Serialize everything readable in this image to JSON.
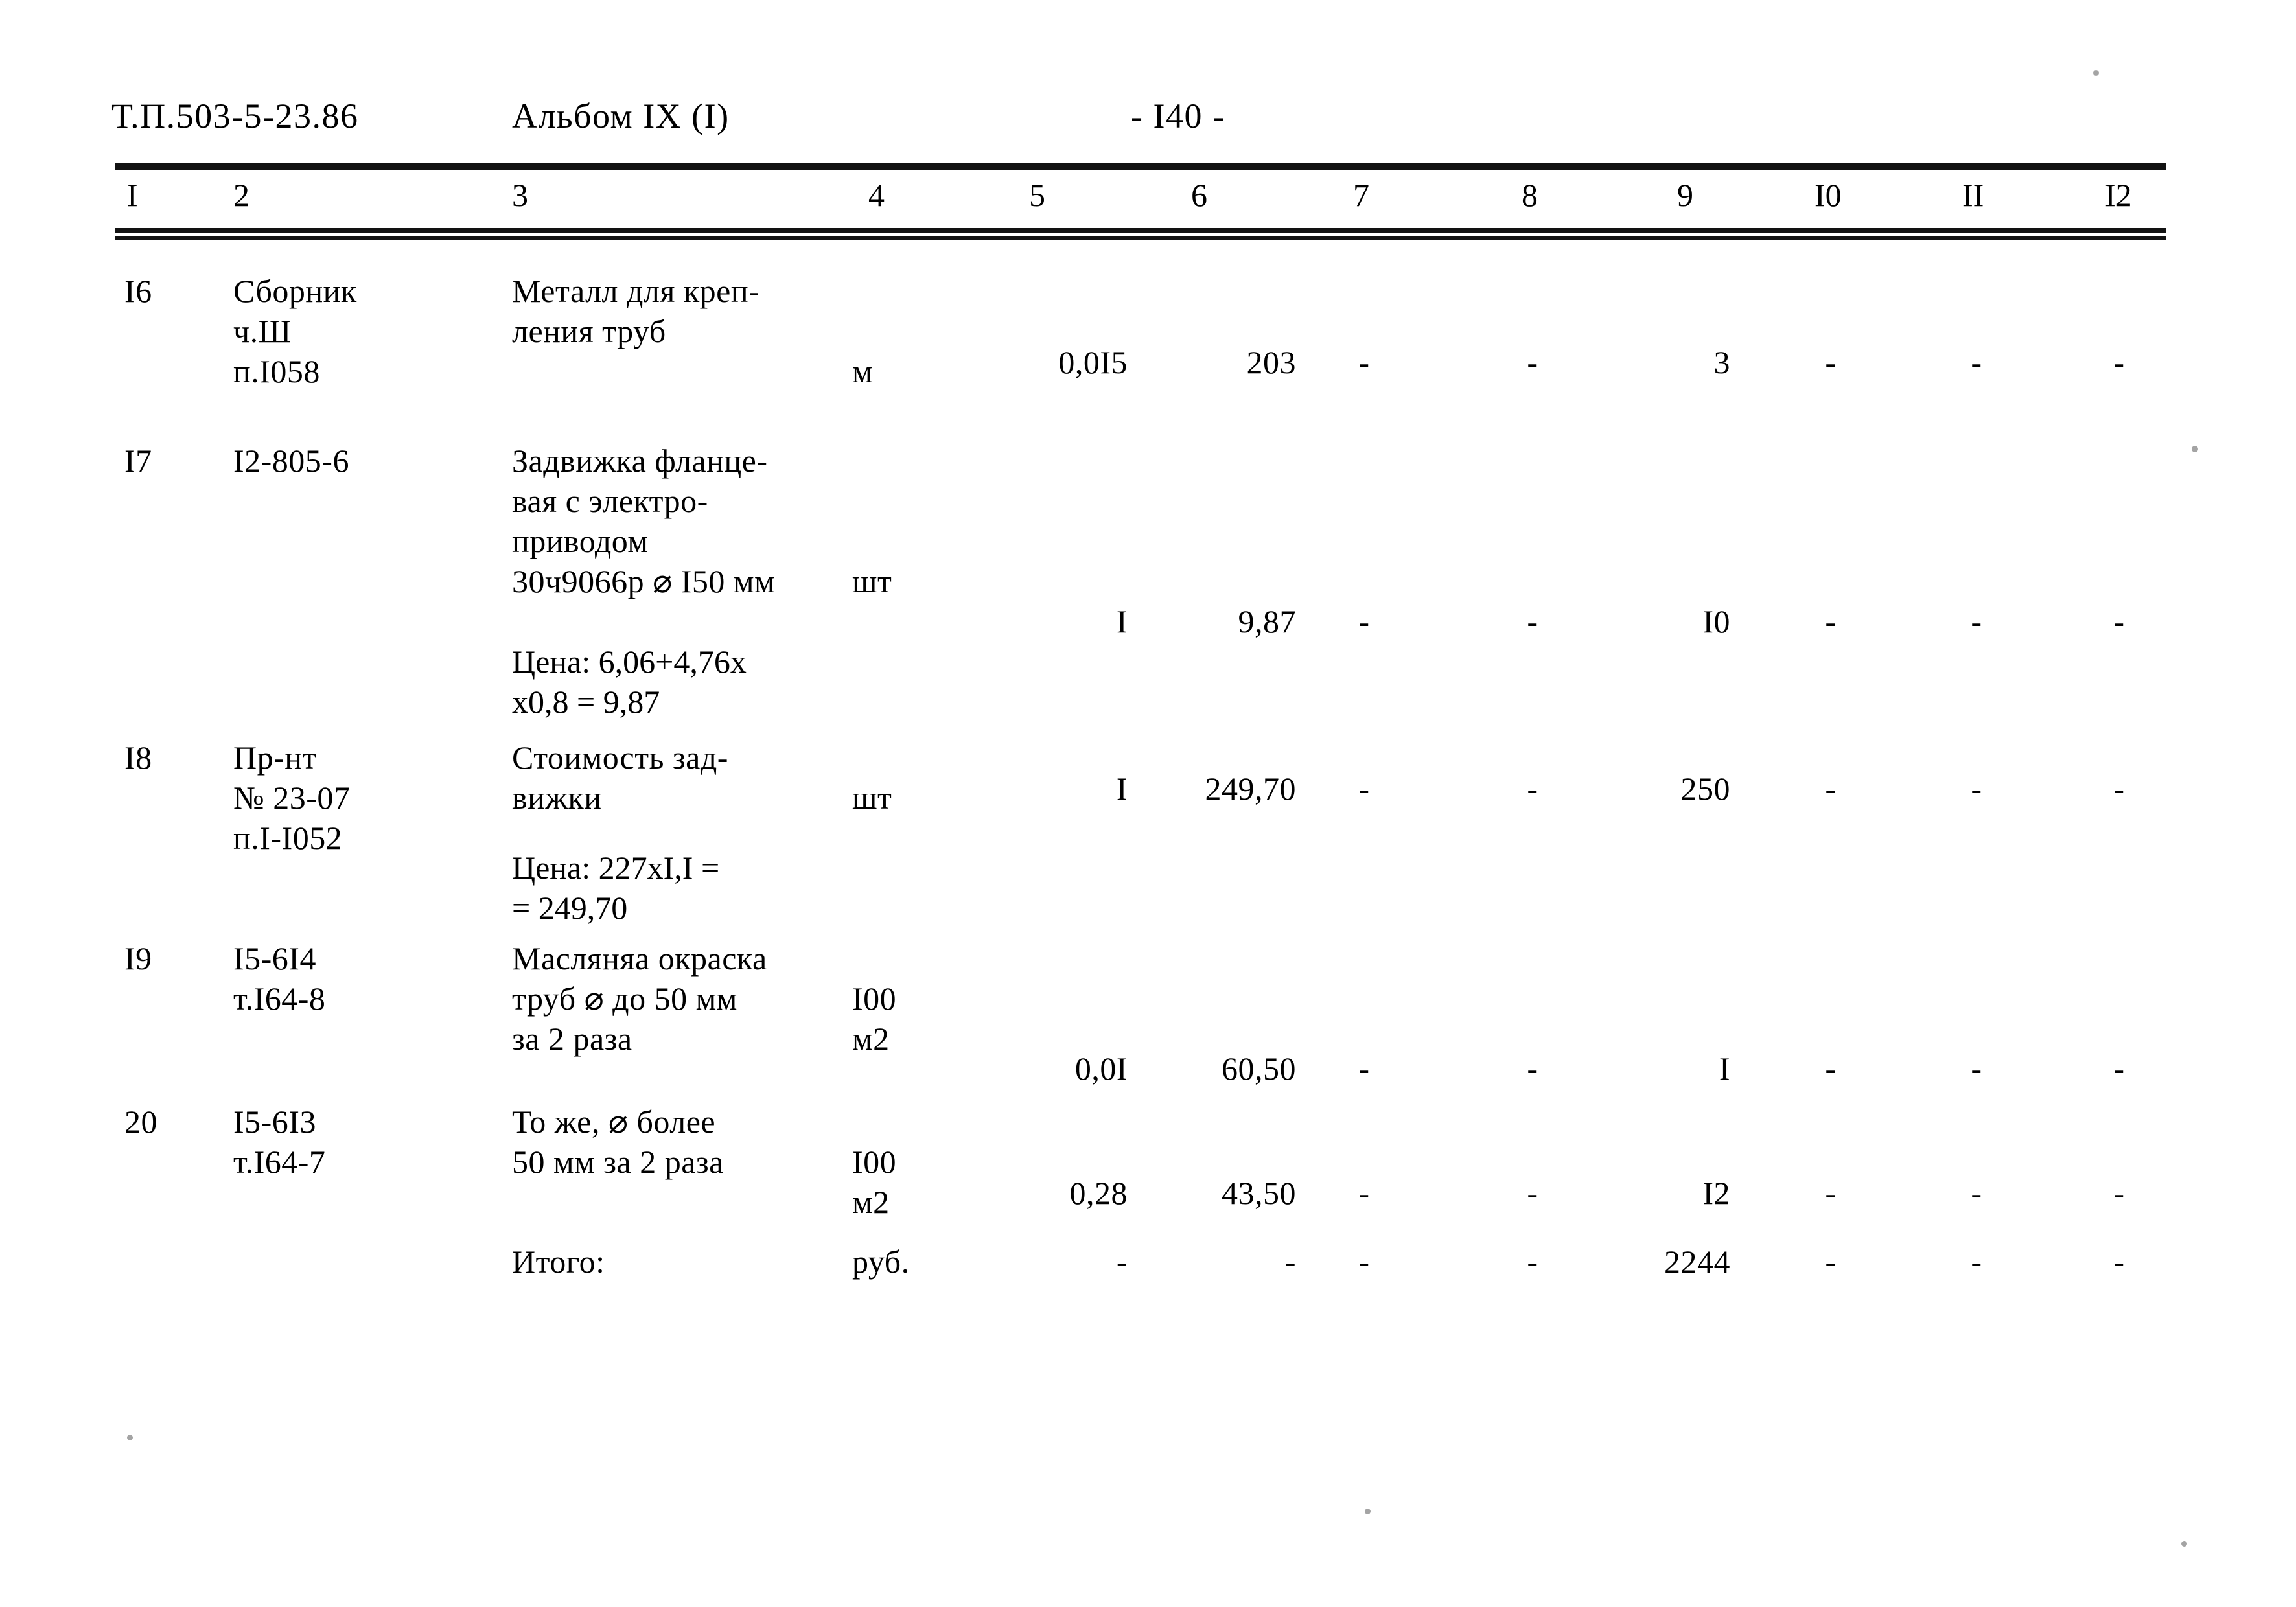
{
  "header": {
    "doc_code": "Т.П.503-5-23.86",
    "album": "Альбом IX (I)",
    "page_number": "- I40 -"
  },
  "table": {
    "column_headers": [
      "I",
      "2",
      "3",
      "4",
      "5",
      "6",
      "7",
      "8",
      "9",
      "I0",
      "II",
      "I2"
    ],
    "rows": [
      {
        "num": "I6",
        "code": "Сборник\nч.Ш\nп.I058",
        "desc": "Металл для креп-\nления труб",
        "unit": "м",
        "qty": "0,0I5",
        "price": "203",
        "c7": "-",
        "c8": "-",
        "c9": "3",
        "c10": "-",
        "c11": "-",
        "c12": "-",
        "note": ""
      },
      {
        "num": "I7",
        "code": "I2-805-6",
        "desc": "Задвижка фланце-\nвая с электро-\nприводом\n30ч9066р ⌀ I50 мм",
        "unit": "шт",
        "qty": "I",
        "price": "9,87",
        "c7": "-",
        "c8": "-",
        "c9": "I0",
        "c10": "-",
        "c11": "-",
        "c12": "-",
        "note": "Цена: 6,06+4,76х\nх0,8 = 9,87"
      },
      {
        "num": "I8",
        "code": "Пр-нт\n№ 23-07\nп.I-I052",
        "desc": "Стоимость зад-\nвижки",
        "unit": "шт",
        "qty": "I",
        "price": "249,70",
        "c7": "-",
        "c8": "-",
        "c9": "250",
        "c10": "-",
        "c11": "-",
        "c12": "-",
        "note": "Цена: 227хI,I =\n= 249,70"
      },
      {
        "num": "I9",
        "code": "I5-6I4\nт.I64-8",
        "desc": "Масляняа окраска\nтруб ⌀ до 50 мм\nза 2 раза",
        "unit": "I00\nм2",
        "qty": "0,0I",
        "price": "60,50",
        "c7": "-",
        "c8": "-",
        "c9": "I",
        "c10": "-",
        "c11": "-",
        "c12": "-",
        "note": ""
      },
      {
        "num": "20",
        "code": "I5-6I3\nт.I64-7",
        "desc": "То же, ⌀ более\n50 мм за 2 раза",
        "unit": "I00\nм2",
        "qty": "0,28",
        "price": "43,50",
        "c7": "-",
        "c8": "-",
        "c9": "I2",
        "c10": "-",
        "c11": "-",
        "c12": "-",
        "note": ""
      }
    ],
    "total_row": {
      "num": "",
      "code": "",
      "desc": "Итого:",
      "unit": "руб.",
      "qty": "-",
      "price": "-",
      "c7": "-",
      "c8": "-",
      "c9": "2244",
      "c10": "-",
      "c11": "-",
      "c12": "-",
      "note": ""
    }
  }
}
